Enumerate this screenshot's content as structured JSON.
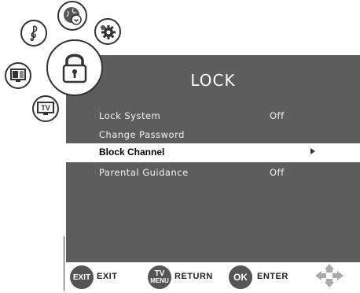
{
  "menu": {
    "title": "LOCK",
    "items": [
      {
        "label": "Lock System",
        "value": "Off",
        "selected": false
      },
      {
        "label": "Change Password",
        "value": "",
        "selected": false
      },
      {
        "label": "Block Channel",
        "value": "",
        "selected": true
      },
      {
        "label": "Parental Guidance",
        "value": "Off",
        "selected": false
      }
    ]
  },
  "category_icons": [
    {
      "name": "music-note-icon"
    },
    {
      "name": "clock-icon"
    },
    {
      "name": "settings-gear-icon"
    },
    {
      "name": "picture-monitor-icon"
    },
    {
      "name": "lock-icon"
    },
    {
      "name": "tv-icon"
    }
  ],
  "tv_icon_text": "TV",
  "footer": {
    "exit_button": "EXIT",
    "exit_label": "EXIT",
    "menu_button_top": "TV",
    "menu_button_bottom": "MENU",
    "return_label": "RETURN",
    "ok_button": "OK",
    "enter_label": "ENTER"
  },
  "colors": {
    "panel": "#5d5d5d",
    "selected_row": "#ffffff",
    "text": "#f2f2f2"
  }
}
